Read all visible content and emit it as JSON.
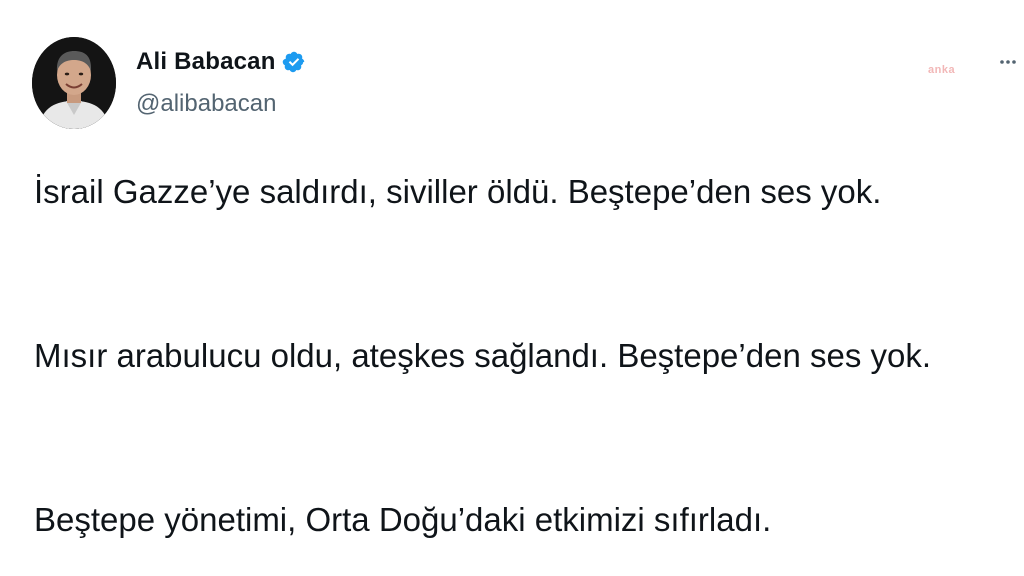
{
  "author": {
    "display_name": "Ali Babacan",
    "handle": "@alibabacan",
    "verified": true,
    "avatar_icon": "profile-photo"
  },
  "watermark": {
    "text": "anka",
    "color": "#f2b7b7"
  },
  "menu": {
    "icon": "more-horizontal-icon"
  },
  "tweet": {
    "paragraphs": [
      "İsrail Gazze’ye saldırdı, siviller öldü. Beştepe’den ses yok.",
      "Mısır arabulucu oldu, ateşkes sağlandı. Beştepe’den ses yok.",
      "Beştepe yönetimi, Orta Doğu’daki etkimizi sıfırladı."
    ]
  },
  "colors": {
    "verified_badge": "#1d9bf0",
    "text_primary": "#0f1419",
    "text_secondary": "#536471"
  }
}
